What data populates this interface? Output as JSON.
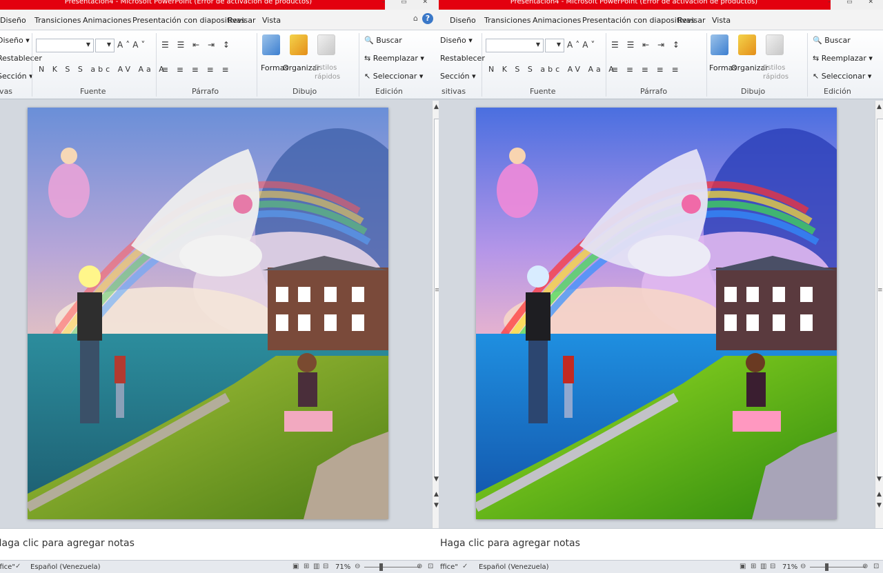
{
  "panes": [
    {
      "title": "Presentación4 - Microsoft PowerPoint (Error de activación de productos)",
      "tabs": [
        "Diseño",
        "Transiciones",
        "Animaciones",
        "Presentación con diapositivas",
        "Revisar",
        "Vista"
      ],
      "ribbon": {
        "slides_group": {
          "label": "ivas",
          "items": [
            "Diseño ▾",
            "Restablecer",
            "Sección ▾"
          ]
        },
        "font_group": {
          "label": "Fuente"
        },
        "paragraph_group": {
          "label": "Párrafo"
        },
        "drawing_group": {
          "label": "Dibujo",
          "shapes": "Formas",
          "arrange": "Organizar",
          "quick_styles": "Estilos rápidos"
        },
        "editing_group": {
          "label": "Edición",
          "find": "Buscar",
          "replace": "Reemplazar ▾",
          "select": "Seleccionar ▾"
        }
      },
      "notes_placeholder": "Haga clic para agregar notas",
      "status": {
        "theme": "ffice\"",
        "language": "Español (Venezuela)",
        "zoom": "71%"
      }
    },
    {
      "title": "Presentación4 - Microsoft PowerPoint (Error de activación de productos)",
      "tabs": [
        "Diseño",
        "Transiciones",
        "Animaciones",
        "Presentación con diapositivas",
        "Revisar",
        "Vista"
      ],
      "ribbon": {
        "slides_group": {
          "label": "sitivas",
          "items": [
            "Diseño ▾",
            "Restablecer",
            "Sección ▾"
          ]
        },
        "font_group": {
          "label": "Fuente"
        },
        "paragraph_group": {
          "label": "Párrafo"
        },
        "drawing_group": {
          "label": "Dibujo",
          "shapes": "Formas",
          "arrange": "Organizar",
          "quick_styles": "Estilos rápidos"
        },
        "editing_group": {
          "label": "Edición",
          "find": "Buscar",
          "replace": "Reemplazar ▾",
          "select": "Seleccionar ▾"
        }
      },
      "notes_placeholder": "Haga clic para agregar notas",
      "status": {
        "theme": "ffice\"",
        "language": "Español (Venezuela)",
        "zoom": "71%"
      }
    }
  ],
  "icons": {
    "help": "?",
    "ribbon_minimize": "⌂",
    "window_controls": "–  ▭  ✕",
    "font_tools": "N K S S abc AV Aa A",
    "paragraph_tools": "≡ ≡ ≡ ≡ ≡",
    "list_tools": "☰ ☰ ⇤ ⇥ ↕",
    "scroll_up": "▲",
    "scroll_down": "▼",
    "view_normal": "▣",
    "view_sorter": "⊞",
    "view_reading": "▥",
    "view_slideshow": "⊟",
    "zoom_out": "⊖",
    "zoom_in": "⊕",
    "fit": "⊡",
    "spell": "✓"
  },
  "colors": {
    "title_bar": "#e3000f",
    "ribbon_bg": "#ffffff",
    "workspace": "#d3d8df",
    "accent_blue": "#3a78c8"
  }
}
